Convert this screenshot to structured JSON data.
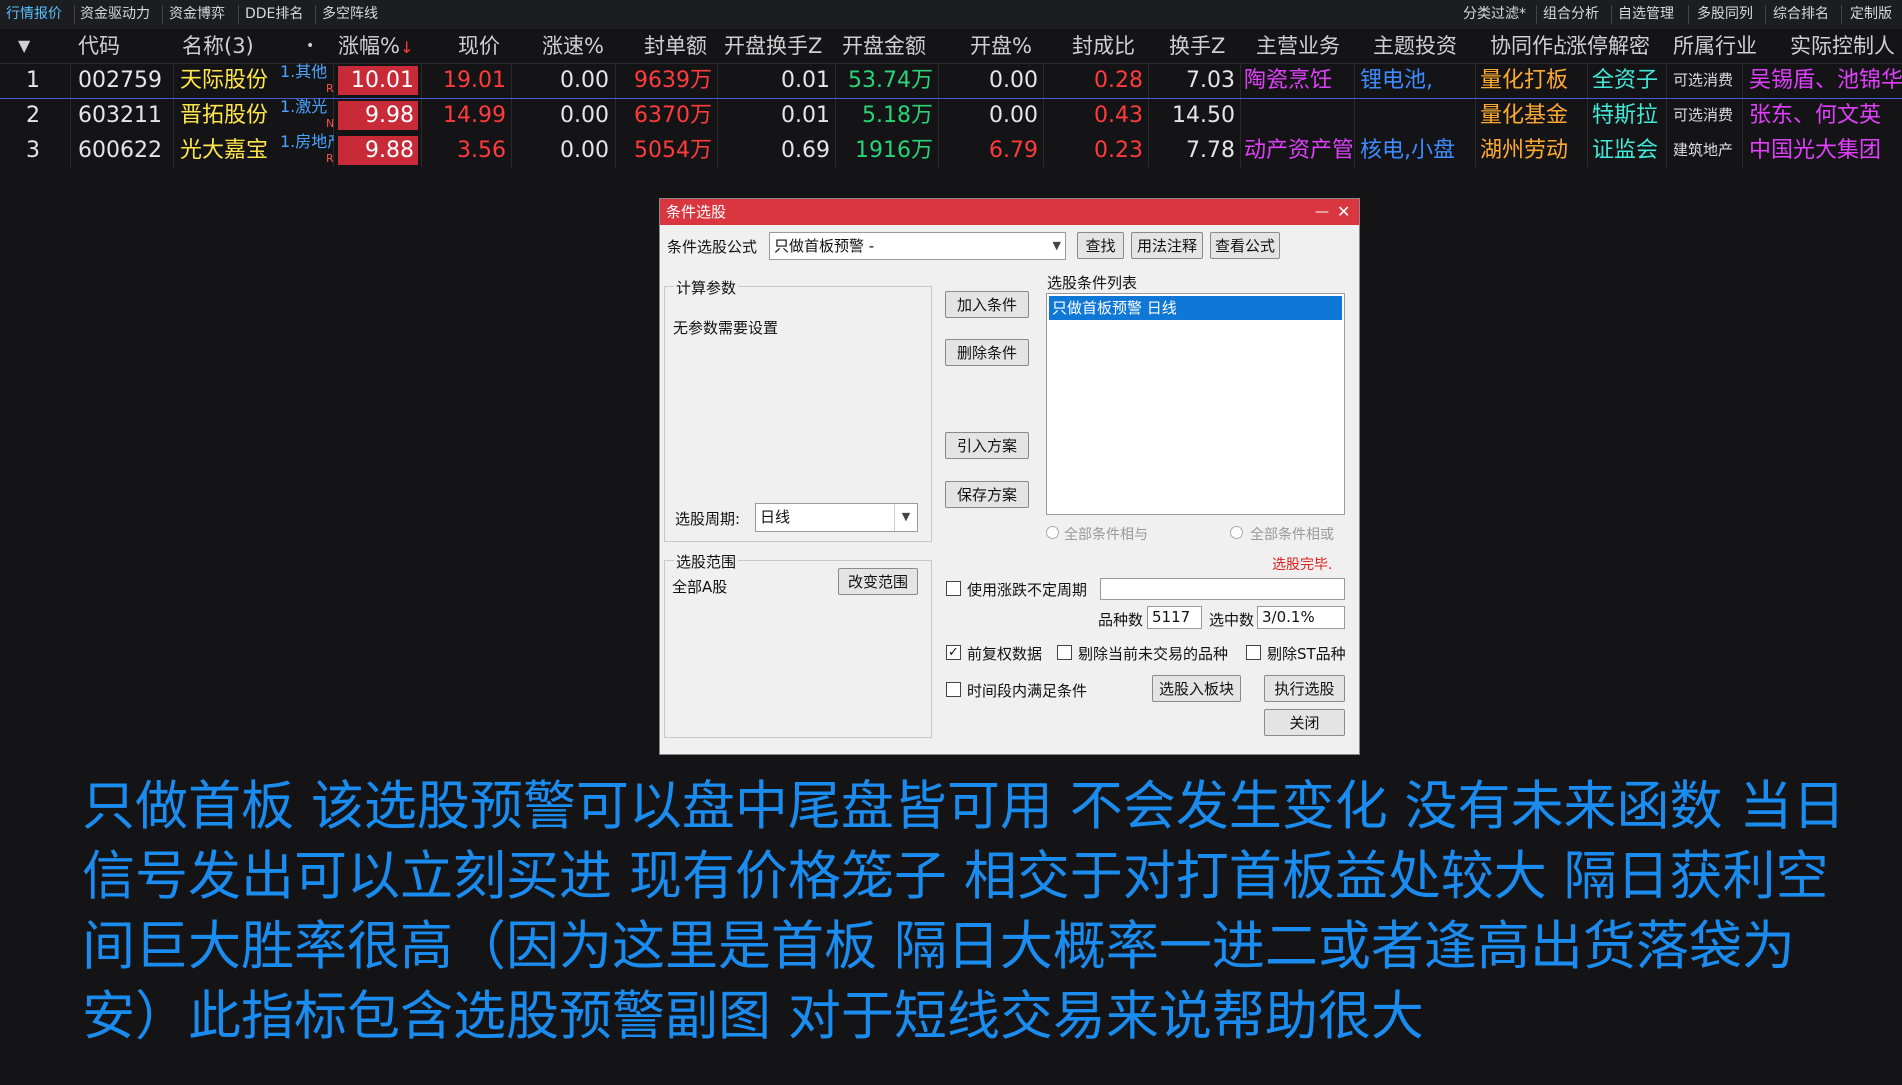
{
  "tabs": [
    "行情报价",
    "资金驱动力",
    "资金博弈",
    "DDE排名",
    "多空阵线"
  ],
  "right_tabs": [
    "分类过滤*",
    "组合分析",
    "自选管理",
    "多股同列",
    "综合排名",
    "定制版"
  ],
  "columns": [
    "代码",
    "名称(3)",
    "涨幅%",
    "现价",
    "涨速%",
    "封单额",
    "开盘换手Z",
    "开盘金额",
    "开盘%",
    "封成比",
    "换手Z",
    "主营业务",
    "主题投资",
    "协同作战",
    "涨停解密",
    "所属行业",
    "实际控制人"
  ],
  "rows": [
    {
      "idx": "1",
      "code": "002759",
      "name": "天际股份",
      "sub": "1.其他",
      "flag": "R",
      "pct": "10.01",
      "price": "19.01",
      "speed": "0.00",
      "seal": "9639万",
      "ohs": "0.01",
      "oamt": "53.74万",
      "open": "0.00",
      "ratio": "0.28",
      "hs": "7.03",
      "main": "陶瓷烹饪",
      "theme": "锂电池,",
      "coop": "量化打板",
      "decode": "全资子",
      "industry": "可选消费",
      "ctrl": "吴锡盾、池锦华"
    },
    {
      "idx": "2",
      "code": "603211",
      "name": "晋拓股份",
      "sub": "1.激光",
      "flag": "N",
      "pct": "9.98",
      "price": "14.99",
      "speed": "0.00",
      "seal": "6370万",
      "ohs": "0.01",
      "oamt": "5.18万",
      "open": "0.00",
      "ratio": "0.43",
      "hs": "14.50",
      "main": "",
      "theme": "",
      "coop": "量化基金",
      "decode": "特斯拉",
      "industry": "可选消费",
      "ctrl": "张东、何文英"
    },
    {
      "idx": "3",
      "code": "600622",
      "name": "光大嘉宝",
      "sub": "1.房地产",
      "flag": "R",
      "pct": "9.88",
      "price": "3.56",
      "speed": "0.00",
      "seal": "5054万",
      "ohs": "0.69",
      "oamt": "1916万",
      "open": "6.79",
      "ratio": "0.23",
      "hs": "7.78",
      "main": "动产资产管",
      "theme": "核电,小盘",
      "coop": "湖州劳动",
      "decode": "证监会",
      "industry": "建筑地产",
      "ctrl": "中国光大集团"
    }
  ],
  "dialog": {
    "title": "条件选股",
    "formula_label": "条件选股公式",
    "formula_value": "只做首板预警 -",
    "btn_find": "查找",
    "btn_usage": "用法注释",
    "btn_view": "查看公式",
    "params_group": "计算参数",
    "params_text": "无参数需要设置",
    "btn_add": "加入条件",
    "btn_delete": "删除条件",
    "btn_import": "引入方案",
    "btn_save": "保存方案",
    "period_label": "选股周期:",
    "period_value": "日线",
    "list_label": "选股条件列表",
    "list_item": "只做首板预警  日线",
    "radio_and": "全部条件相与",
    "radio_or": "全部条件相或",
    "status": "选股完毕.",
    "scope_group": "选股范围",
    "scope_value": "全部A股",
    "btn_scope": "改变范围",
    "chk_period": "使用涨跌不定周期",
    "count_label": "品种数",
    "count_value": "5117",
    "hit_label": "选中数",
    "hit_value": "3/0.1%",
    "chk_adjust": "前复权数据",
    "chk_untraded": "剔除当前未交易的品种",
    "chk_st": "剔除ST品种",
    "chk_timerange": "时间段内满足条件",
    "btn_to_block": "选股入板块",
    "btn_execute": "执行选股",
    "btn_close": "关闭"
  },
  "caption": "只做首板 该选股预警可以盘中尾盘皆可用  不会发生变化 没有未来函数 当日信号发出可以立刻买进 现有价格笼子 相交于对打首板益处较大 隔日获利空间巨大胜率很高（因为这里是首板 隔日大概率一进二或者逢高出货落袋为安）此指标包含选股预警副图 对于短线交易来说帮助很大"
}
